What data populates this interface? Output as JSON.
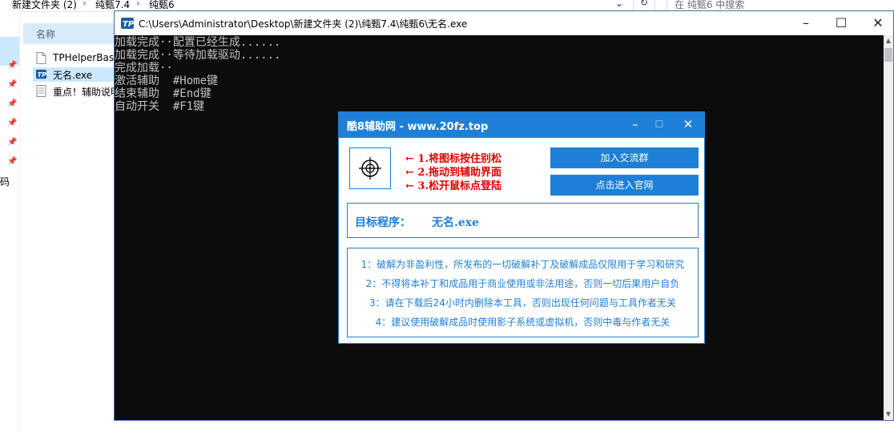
{
  "explorer": {
    "breadcrumb": [
      "新建文件夹 (2)",
      "纯甄7.4",
      "纯甄6"
    ],
    "search_placeholder": "在 纯甄6 中搜索",
    "column_name": "名称",
    "nav_label": "源码",
    "files": [
      "TPHelperBase",
      "无名.exe",
      "重点！辅助说明"
    ]
  },
  "console": {
    "title": "C:\\Users\\Administrator\\Desktop\\新建文件夹 (2)\\纯甄7.4\\纯甄6\\无名.exe",
    "lines": [
      "加载完成··配置已经生成......",
      "加载完成··等待加载驱动......",
      "完成加载··",
      "激活辅助  #Home键",
      "结束辅助  #End键",
      "自动开关  #F1键"
    ]
  },
  "dialog": {
    "title": "酷8辅助网 - www.20fz.top",
    "instructions": [
      "←  1.将图标按住别松",
      "←  2.拖动到辅助界面",
      "←  3.松开鼠标点登陆"
    ],
    "btn_join": "加入交流群",
    "btn_site": "点击进入官网",
    "target_label": "目标程序：",
    "target_value": "无名.exe",
    "disclaimers": [
      "1：破解为非盈利性，所发布的一切破解补丁及破解成品仅限用于学习和研究",
      "2：不得将本补丁和成品用于商业使用或非法用途，否则一切后果用户自负",
      "3：请在下载后24小时内删除本工具，否则出现任何问题与工具作者无关",
      "4：建议使用破解成品时使用影子系统或虚拟机，否则中毒与作者无关"
    ]
  },
  "colors": {
    "dialog_blue": "#1e7fd6",
    "instruction_red": "#e00000",
    "console_bg": "#0c0c0c"
  },
  "icons": [
    "chevron-right-icon",
    "pin-icon",
    "file-icon",
    "exe-icon",
    "text-file-icon",
    "crosshair-icon",
    "minimize-icon",
    "maximize-icon",
    "close-icon"
  ]
}
